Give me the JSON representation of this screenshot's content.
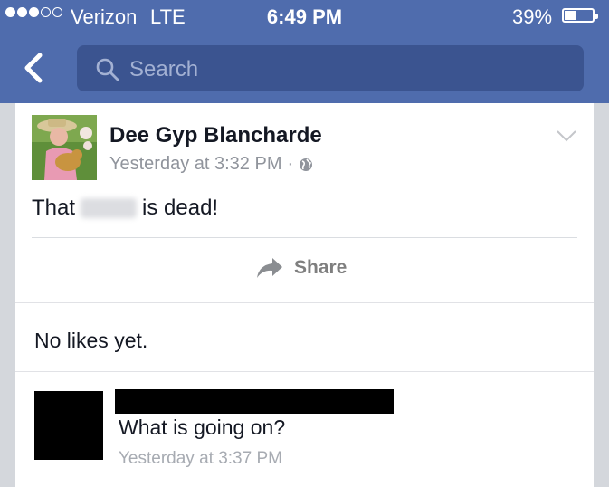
{
  "status_bar": {
    "carrier": "Verizon",
    "network": "LTE",
    "time": "6:49 PM",
    "battery": "39%",
    "battery_level": 0.39,
    "signal_bars_filled": 3,
    "signal_bars_total": 5
  },
  "nav": {
    "back_icon": "chevron-left-icon",
    "search_placeholder": "Search",
    "search_value": ""
  },
  "post": {
    "author": "Dee Gyp Blancharde",
    "timestamp": "Yesterday at 3:32 PM",
    "separator": "·",
    "privacy_icon": "globe-icon",
    "options_icon": "chevron-down-icon",
    "text_before": "That",
    "text_after": "is dead!",
    "share_label": "Share",
    "likes_text": "No likes yet."
  },
  "comment": {
    "text": "What is going on?",
    "timestamp": "Yesterday at 3:37 PM"
  },
  "colors": {
    "header_blue": "#4f6cad",
    "search_bg": "#3b5490",
    "text_dark": "#141823",
    "text_muted": "#90949c"
  }
}
